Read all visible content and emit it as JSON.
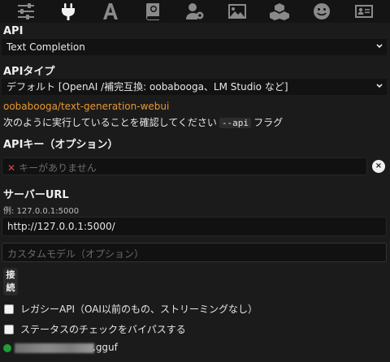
{
  "toolbar": {
    "icons": [
      "sliders-icon",
      "plug-icon",
      "font-icon",
      "book-icon",
      "user-gear-icon",
      "image-icon",
      "cubes-icon",
      "smile-icon",
      "id-card-icon"
    ],
    "active": "plug-icon"
  },
  "api": {
    "label": "API",
    "selected": "Text Completion"
  },
  "api_type": {
    "label": "APIタイプ",
    "selected": "デフォルト [OpenAI /補完互換: oobabooga、LM Studio など]"
  },
  "link": {
    "text": "oobabooga/text-generation-webui"
  },
  "instructions": {
    "prefix": "次のように実行していることを確認してください",
    "code": "--api",
    "suffix": "フラグ"
  },
  "api_key": {
    "label": "APIキー（オプション）",
    "placeholder": "キーがありません",
    "clear_glyph": "×"
  },
  "server_url": {
    "label": "サーバーURL",
    "example": "例: 127.0.0.1:5000",
    "value": "http://127.0.0.1:5000/"
  },
  "custom_model": {
    "placeholder": "カスタムモデル（オプション）"
  },
  "connect_button": {
    "line1": "接",
    "line2": "続"
  },
  "checkboxes": {
    "legacy_api": "レガシーAPI（OAI以前のもの、ストリーミングなし）",
    "bypass_status": "ステータスのチェックをバイパスする"
  },
  "status": {
    "suffix": ".gguf",
    "color": "#1f9d3a"
  }
}
